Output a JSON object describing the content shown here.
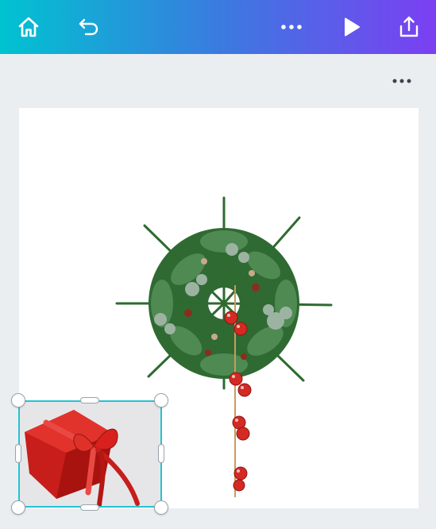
{
  "colors": {
    "toolbar_gradient_start": "#00c3d0",
    "toolbar_gradient_mid": "#3a7be0",
    "toolbar_gradient_end": "#7b3ff2",
    "workspace_background": "#ebeef1",
    "selection_border": "#22c4d2",
    "page_background": "#ffffff",
    "icon_color": "#ffffff",
    "more_dots_color": "#3c4450"
  },
  "toolbar": {
    "icons": [
      "home-icon",
      "undo-icon",
      "more-options-icon",
      "present-icon",
      "share-icon"
    ]
  },
  "page": {
    "options_icon": "more-options-icon",
    "elements": [
      {
        "kind": "image",
        "subject": "christmas-wreath"
      },
      {
        "kind": "image",
        "subject": "red-gift-box",
        "selected": true
      }
    ]
  }
}
